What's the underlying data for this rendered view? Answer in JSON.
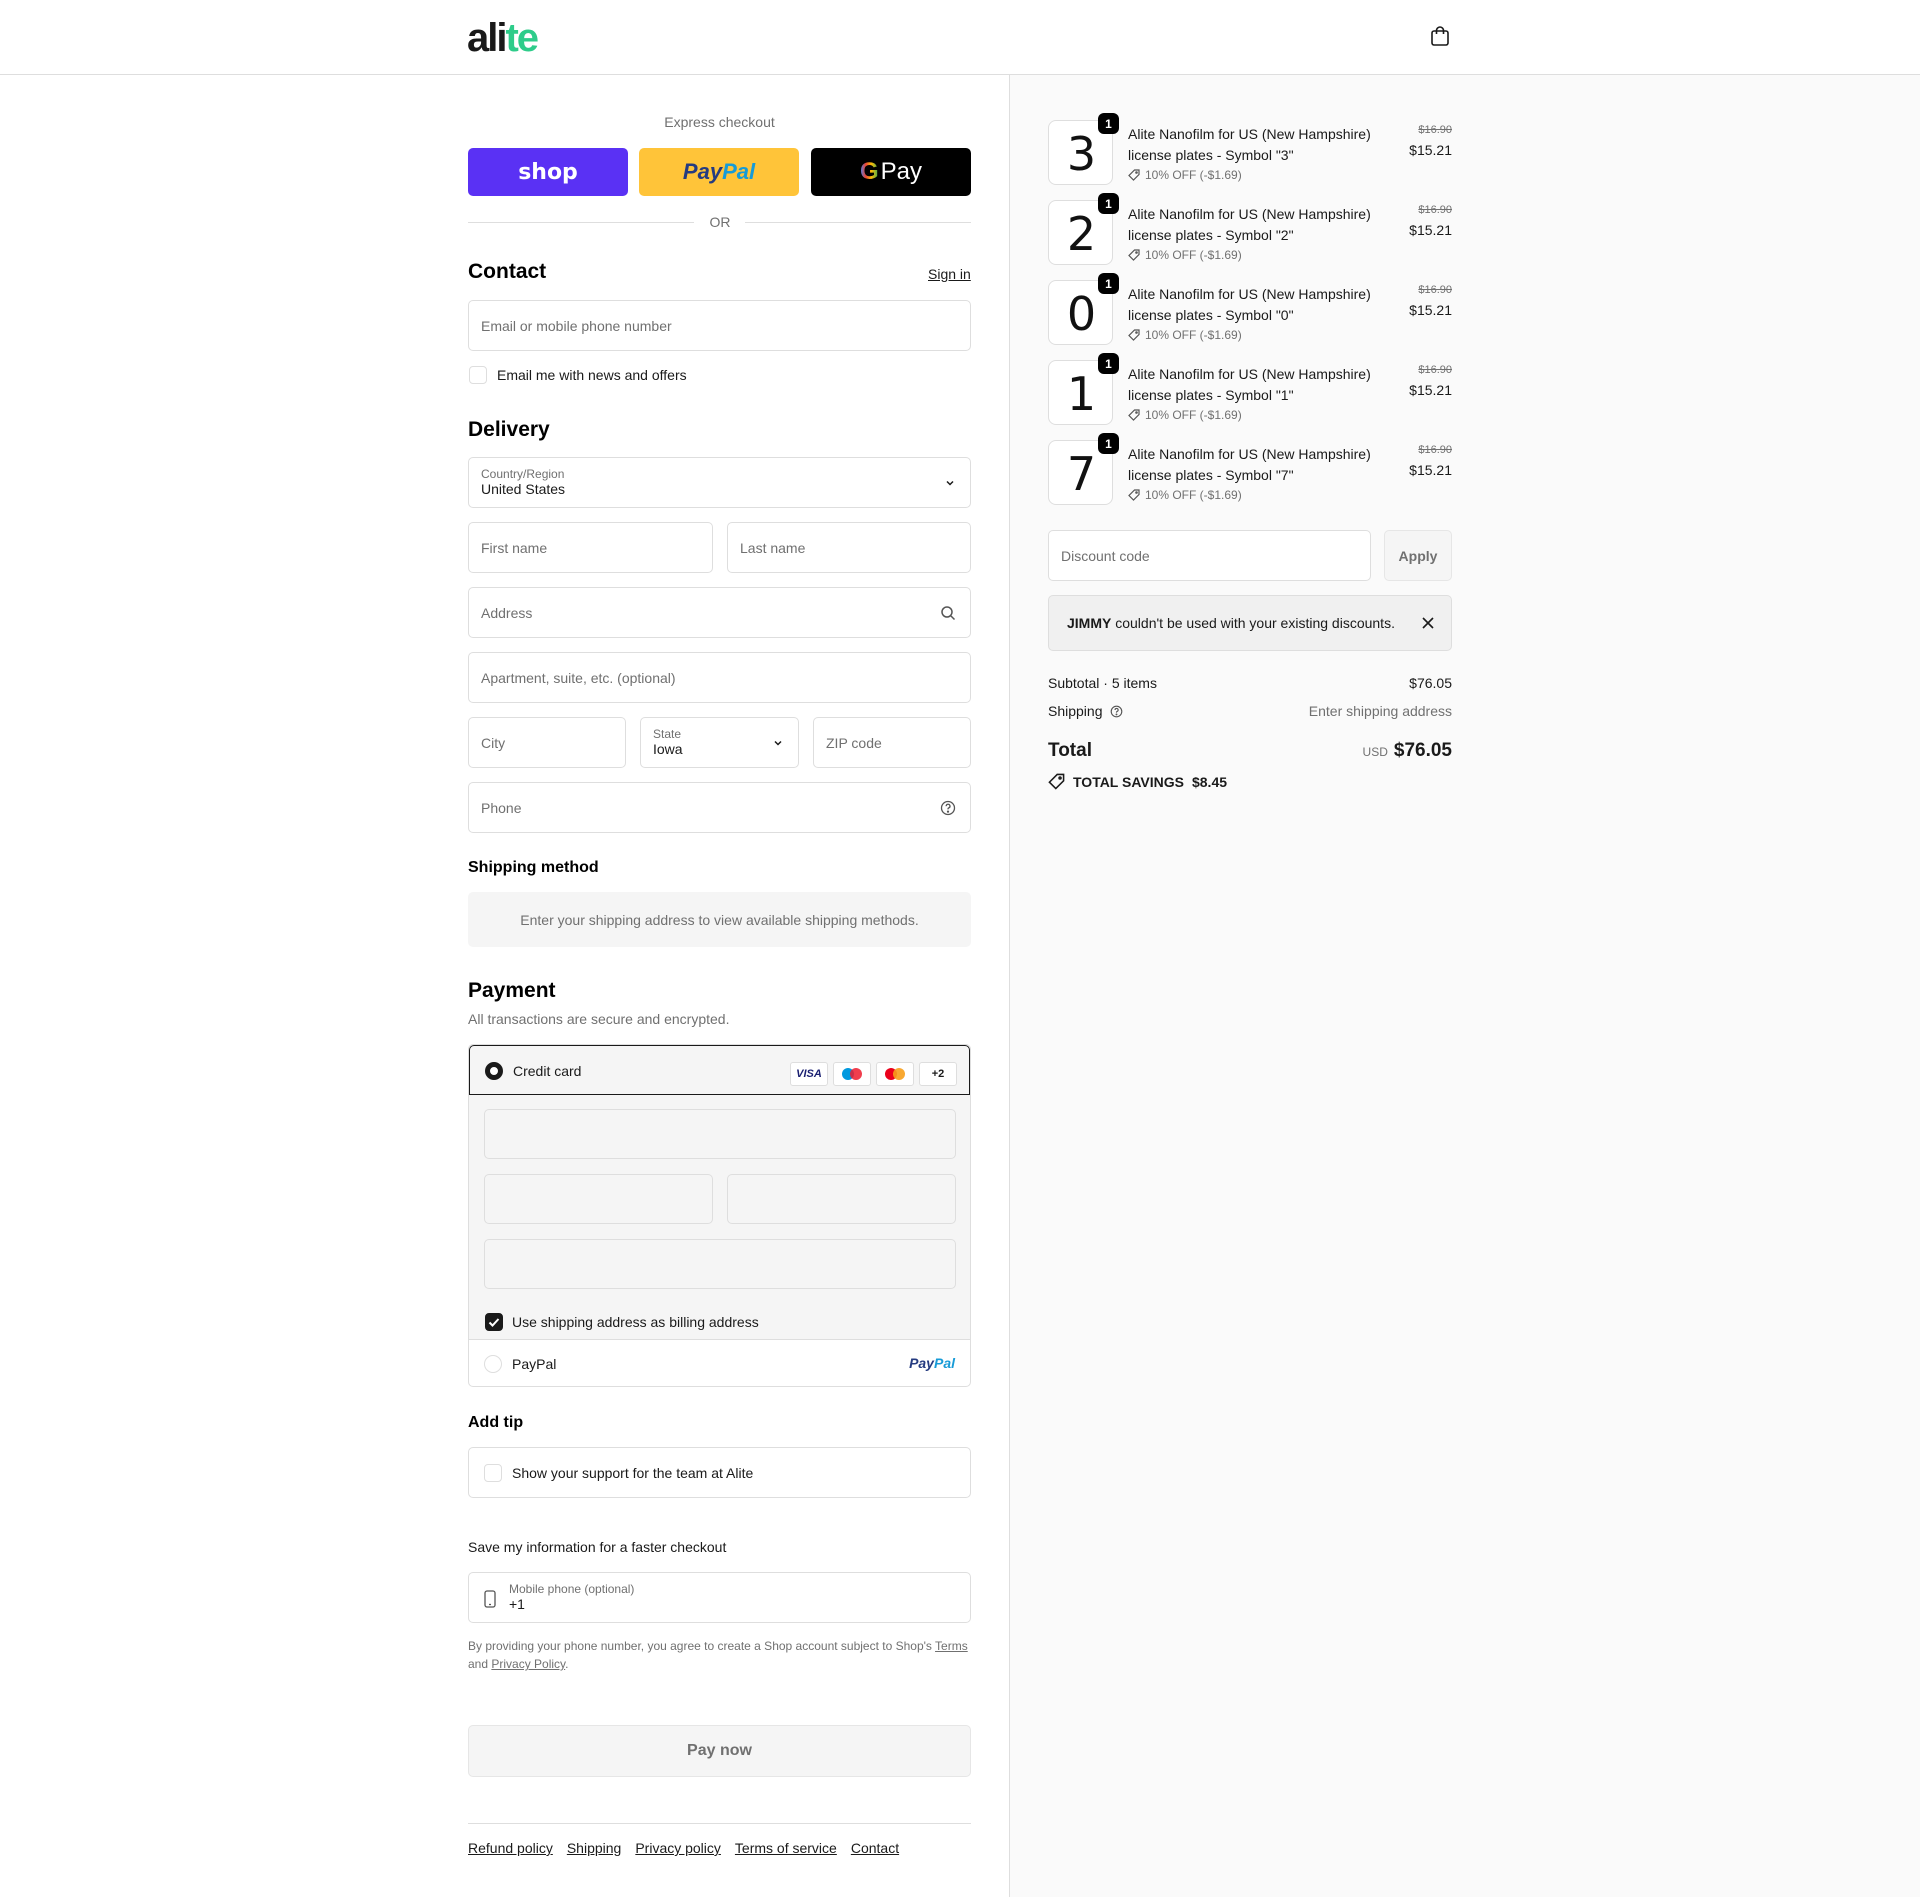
{
  "header": {
    "logo_main": "ali",
    "logo_accent": "te"
  },
  "express": {
    "label": "Express checkout",
    "shop": "shop",
    "paypal_a": "Pay",
    "paypal_b": "Pal",
    "gpay_g": "G",
    "gpay_text": "Pay",
    "or": "OR"
  },
  "contact": {
    "title": "Contact",
    "sign_in": "Sign in",
    "email_placeholder": "Email or mobile phone number",
    "news_label": "Email me with news and offers"
  },
  "delivery": {
    "title": "Delivery",
    "country_label": "Country/Region",
    "country_value": "United States",
    "first_name": "First name",
    "last_name": "Last name",
    "address": "Address",
    "apartment": "Apartment, suite, etc. (optional)",
    "city": "City",
    "state_label": "State",
    "state_value": "Iowa",
    "zip": "ZIP code",
    "phone": "Phone"
  },
  "shipping_method": {
    "title": "Shipping method",
    "message": "Enter your shipping address to view available shipping methods."
  },
  "payment": {
    "title": "Payment",
    "subtitle": "All transactions are secure and encrypted.",
    "credit_card": "Credit card",
    "badges": [
      "VISA",
      "",
      "",
      "+2"
    ],
    "billing_label": "Use shipping address as billing address",
    "paypal": "PayPal",
    "paypal_logo_a": "Pay",
    "paypal_logo_b": "Pal"
  },
  "tip": {
    "title": "Add tip",
    "label": "Show your support for the team at Alite"
  },
  "save": {
    "title": "Save my information for a faster checkout",
    "mobile_label": "Mobile phone (optional)",
    "mobile_value": "+1",
    "legal_1": "By providing your phone number, you agree to create a Shop account subject to Shop's",
    "terms": "Terms",
    "legal_2": "and",
    "privacy": "Privacy Policy",
    "legal_3": "."
  },
  "pay_now": "Pay now",
  "footer": [
    "Refund policy",
    "Shipping",
    "Privacy policy",
    "Terms of service",
    "Contact"
  ],
  "items": [
    {
      "glyph": "3",
      "qty": "1",
      "name": "Alite Nanofilm for US (New Hampshire) license plates - Symbol \"3\"",
      "discount": "10% OFF (-$1.69)",
      "old_price": "$16.90",
      "price": "$15.21"
    },
    {
      "glyph": "2",
      "qty": "1",
      "name": "Alite Nanofilm for US (New Hampshire) license plates - Symbol \"2\"",
      "discount": "10% OFF (-$1.69)",
      "old_price": "$16.90",
      "price": "$15.21"
    },
    {
      "glyph": "0",
      "qty": "1",
      "name": "Alite Nanofilm for US (New Hampshire) license plates - Symbol \"0\"",
      "discount": "10% OFF (-$1.69)",
      "old_price": "$16.90",
      "price": "$15.21"
    },
    {
      "glyph": "1",
      "qty": "1",
      "name": "Alite Nanofilm for US (New Hampshire) license plates - Symbol \"1\"",
      "discount": "10% OFF (-$1.69)",
      "old_price": "$16.90",
      "price": "$15.21"
    },
    {
      "glyph": "7",
      "qty": "1",
      "name": "Alite Nanofilm for US (New Hampshire) license plates - Symbol \"7\"",
      "discount": "10% OFF (-$1.69)",
      "old_price": "$16.90",
      "price": "$15.21"
    }
  ],
  "discount": {
    "placeholder": "Discount code",
    "apply": "Apply",
    "alert_code": "JIMMY",
    "alert_text": " couldn't be used with your existing discounts."
  },
  "summary": {
    "subtotal_label": "Subtotal · 5 items",
    "subtotal_value": "$76.05",
    "shipping_label": "Shipping",
    "shipping_value": "Enter shipping address",
    "total_label": "Total",
    "currency": "USD",
    "total_value": "$76.05",
    "savings_label": "TOTAL SAVINGS",
    "savings_value": "$8.45"
  }
}
